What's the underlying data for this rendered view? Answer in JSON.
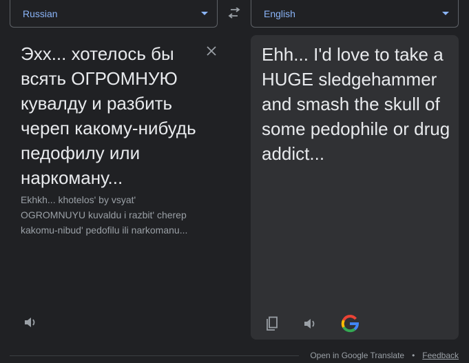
{
  "source": {
    "language": "Russian",
    "text": "Эхх... хотелось бы всять ОГРОМНУЮ кувалду и разбить череп какому-нибудь педофилу или наркоману...",
    "transliteration": "Ekhkh... khotelos' by vsyat' OGROMNUYU kuvaldu i razbit' cherep kakomu-nibud' pedofilu ili narkomanu..."
  },
  "target": {
    "language": "English",
    "text": "Ehh... I'd love to take a HUGE sledgehammer and smash the skull of some pedophile or drug addict..."
  },
  "icons": {
    "swap": "swap-arrows-icon",
    "clear": "close-icon",
    "speaker": "speaker-icon",
    "copy": "copy-icon",
    "google": "google-logo"
  },
  "footer": {
    "open_link": "Open in Google Translate",
    "separator": "•",
    "feedback": "Feedback"
  },
  "colors": {
    "background": "#202124",
    "panel": "#303134",
    "accent": "#8ab4f8",
    "text": "#e8eaed",
    "muted": "#9aa0a6"
  }
}
